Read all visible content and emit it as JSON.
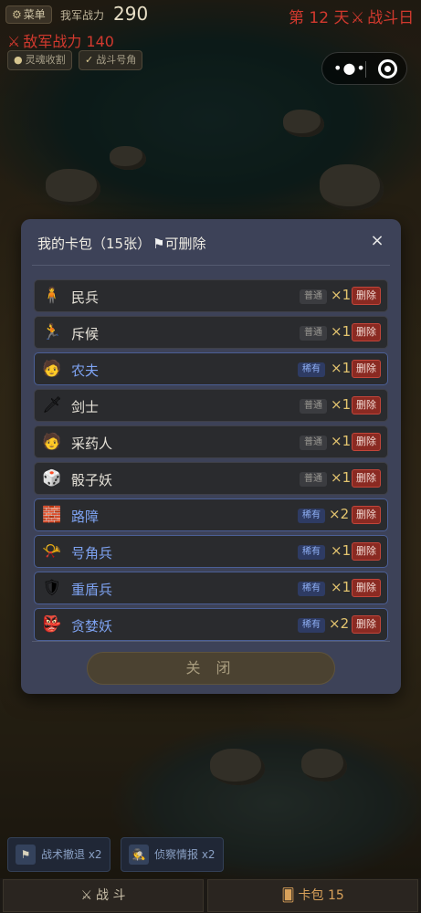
{
  "hud": {
    "menu_label": "菜单",
    "our_power_label": "我军战力",
    "our_power_value": "290",
    "day_label": "第 12 天",
    "battle_day_label": "战斗日",
    "enemy_power_label": "敌军战力 140",
    "buffs": [
      "灵魂收割",
      "战斗号角"
    ]
  },
  "modal": {
    "title": "我的卡包（15张）",
    "deletable_label": "可删除",
    "close_icon": "×",
    "close_button_label": "关 闭",
    "cards": [
      {
        "name": "民兵",
        "rarity": "普通",
        "count": "×1",
        "delete": "删除",
        "icon": "militia-icon",
        "glyph": "🧍"
      },
      {
        "name": "斥候",
        "rarity": "普通",
        "count": "×1",
        "delete": "删除",
        "icon": "scout-icon",
        "glyph": "🏃"
      },
      {
        "name": "农夫",
        "rarity": "稀有",
        "count": "×1",
        "delete": "删除",
        "icon": "farmer-icon",
        "glyph": "🧑"
      },
      {
        "name": "剑士",
        "rarity": "普通",
        "count": "×1",
        "delete": "删除",
        "icon": "swordsman-icon",
        "glyph": "🗡"
      },
      {
        "name": "采药人",
        "rarity": "普通",
        "count": "×1",
        "delete": "删除",
        "icon": "herbalist-icon",
        "glyph": "🧑"
      },
      {
        "name": "骰子妖",
        "rarity": "普通",
        "count": "×1",
        "delete": "删除",
        "icon": "dice-demon-icon",
        "glyph": "🎲"
      },
      {
        "name": "路障",
        "rarity": "稀有",
        "count": "×2",
        "delete": "删除",
        "icon": "barricade-icon",
        "glyph": "🧱"
      },
      {
        "name": "号角兵",
        "rarity": "稀有",
        "count": "×1",
        "delete": "删除",
        "icon": "horn-soldier-icon",
        "glyph": "📯"
      },
      {
        "name": "重盾兵",
        "rarity": "稀有",
        "count": "×1",
        "delete": "删除",
        "icon": "shield-soldier-icon",
        "glyph": "🛡"
      },
      {
        "name": "贪婪妖",
        "rarity": "稀有",
        "count": "×2",
        "delete": "删除",
        "icon": "greed-demon-icon",
        "glyph": "👺"
      }
    ]
  },
  "items": [
    {
      "label": "战术撤退 x2",
      "icon": "flag-icon",
      "glyph": "⚑"
    },
    {
      "label": "侦察情报 x2",
      "icon": "scout-report-icon",
      "glyph": "🕵"
    }
  ],
  "tabs": {
    "battle_label": "战 斗",
    "deck_label": "卡包 15"
  },
  "colors": {
    "rare_blue": "#7ea3f2",
    "enemy_red": "#d2392e",
    "delete_red": "#8a2a22",
    "count_gold": "#e3c46f"
  }
}
